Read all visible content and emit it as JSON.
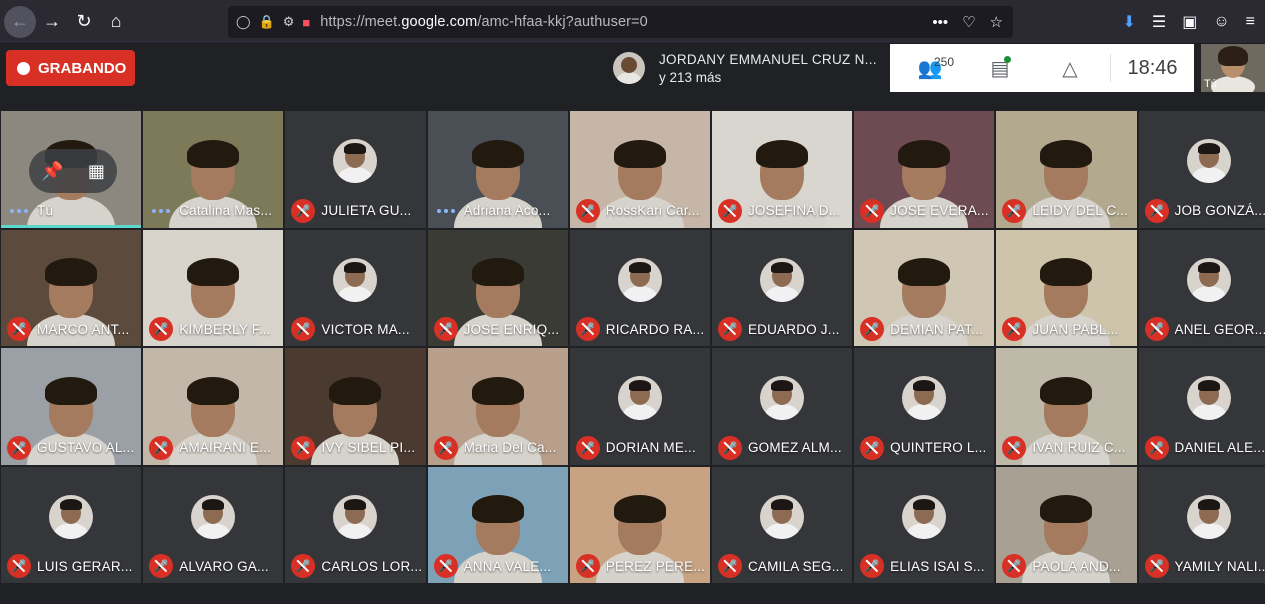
{
  "browser": {
    "url_prefix": "https://meet.",
    "url_domain": "google.com",
    "url_path": "/amc-hfaa-kkj?authuser=0",
    "url_more": "•••"
  },
  "meet": {
    "recording_label": "GRABANDO",
    "presenter_name": "JORDANY EMMANUEL CRUZ N...",
    "presenter_more": "y 213 más",
    "people_count": "250",
    "clock": "18:46",
    "self_label": "Tú"
  },
  "tiles": [
    {
      "name": "Tú",
      "state": "speaking",
      "kind": "video",
      "bg": "#8c8880",
      "self": true
    },
    {
      "name": "Catalina Mas...",
      "state": "speaking",
      "kind": "video",
      "bg": "#7d7a5a"
    },
    {
      "name": "JULIETA GU...",
      "state": "muted",
      "kind": "avatar",
      "bg": "#35363a"
    },
    {
      "name": "Adriana Aco...",
      "state": "speaking",
      "kind": "video",
      "bg": "#4a4f55"
    },
    {
      "name": "RossKari Car...",
      "state": "muted",
      "kind": "video",
      "bg": "#c6b6a8"
    },
    {
      "name": "JOSEFINA D...",
      "state": "muted",
      "kind": "video",
      "bg": "#d9d6cf"
    },
    {
      "name": "JOSE EVERA...",
      "state": "muted",
      "kind": "video",
      "bg": "#6e4a52"
    },
    {
      "name": "LEIDY DEL C...",
      "state": "muted",
      "kind": "video",
      "bg": "#b3a98f"
    },
    {
      "name": "JOB GONZÁ...",
      "state": "muted",
      "kind": "avatar",
      "bg": "#35363a"
    },
    {
      "name": "MARCO ANT...",
      "state": "muted",
      "kind": "video",
      "bg": "#5c4a3c"
    },
    {
      "name": "KIMBERLY F...",
      "state": "muted",
      "kind": "video",
      "bg": "#d8d3cb"
    },
    {
      "name": "VICTOR MA...",
      "state": "muted",
      "kind": "avatar",
      "bg": "#35363a"
    },
    {
      "name": "JOSE ENRIQ...",
      "state": "muted",
      "kind": "video",
      "bg": "#3b3b36"
    },
    {
      "name": "RICARDO RA...",
      "state": "muted",
      "kind": "avatar",
      "bg": "#35363a"
    },
    {
      "name": "EDUARDO J...",
      "state": "muted",
      "kind": "avatar",
      "bg": "#35363a"
    },
    {
      "name": "DEMIAN PAT...",
      "state": "muted",
      "kind": "video",
      "bg": "#cfc6b4"
    },
    {
      "name": "JUAN PABL...",
      "state": "muted",
      "kind": "video",
      "bg": "#cec4ac"
    },
    {
      "name": "ANEL GEOR...",
      "state": "muted",
      "kind": "avatar",
      "bg": "#35363a"
    },
    {
      "name": "GUSTAVO AL...",
      "state": "muted",
      "kind": "video",
      "bg": "#9aa0a6"
    },
    {
      "name": "AMAIRANI E...",
      "state": "muted",
      "kind": "video",
      "bg": "#c2b7a8"
    },
    {
      "name": "IVY SIBEL PI...",
      "state": "muted",
      "kind": "video",
      "bg": "#4a3a30"
    },
    {
      "name": "Maria Del Ca...",
      "state": "muted",
      "kind": "video",
      "bg": "#b79f8c"
    },
    {
      "name": "DORIAN ME...",
      "state": "muted",
      "kind": "avatar",
      "bg": "#35363a"
    },
    {
      "name": "GOMEZ ALM...",
      "state": "muted",
      "kind": "avatar",
      "bg": "#35363a"
    },
    {
      "name": "QUINTERO L...",
      "state": "muted",
      "kind": "avatar",
      "bg": "#35363a"
    },
    {
      "name": "IVAN RUIZ C...",
      "state": "muted",
      "kind": "video",
      "bg": "#bfb9aa"
    },
    {
      "name": "DANIEL ALE...",
      "state": "muted",
      "kind": "avatar",
      "bg": "#35363a"
    },
    {
      "name": "LUIS GERAR...",
      "state": "muted",
      "kind": "avatar",
      "bg": "#35363a"
    },
    {
      "name": "ALVARO GA...",
      "state": "muted",
      "kind": "avatar",
      "bg": "#35363a"
    },
    {
      "name": "CARLOS LOR...",
      "state": "muted",
      "kind": "avatar",
      "bg": "#35363a"
    },
    {
      "name": "ANNA VALE...",
      "state": "muted",
      "kind": "video",
      "bg": "#7da2b8"
    },
    {
      "name": "PEREZ PERE...",
      "state": "muted",
      "kind": "video",
      "bg": "#c7a384"
    },
    {
      "name": "CAMILA SEG...",
      "state": "muted",
      "kind": "avatar",
      "bg": "#35363a"
    },
    {
      "name": "ELIAS ISAI S...",
      "state": "muted",
      "kind": "avatar",
      "bg": "#35363a"
    },
    {
      "name": "PAOLA AND...",
      "state": "muted",
      "kind": "video",
      "bg": "#a8a092"
    },
    {
      "name": "YAMILY NALI...",
      "state": "muted",
      "kind": "avatar",
      "bg": "#35363a"
    }
  ]
}
